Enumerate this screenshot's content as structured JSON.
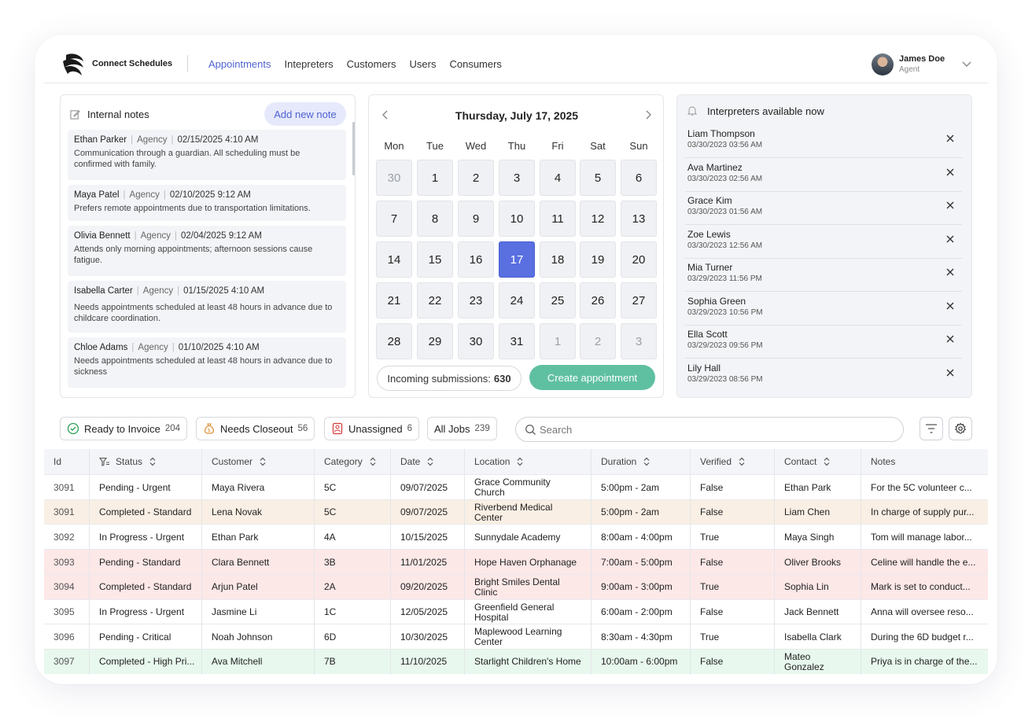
{
  "app": {
    "brand": "Connect Schedules",
    "nav": [
      "Appointments",
      "Intepreters",
      "Customers",
      "Users",
      "Consumers"
    ],
    "active_nav": "Appointments",
    "user": {
      "name": "James Doe",
      "role": "Agent"
    }
  },
  "notes": {
    "title": "Internal notes",
    "add_label": "Add new note",
    "items": [
      {
        "name": "Ethan Parker",
        "org": "Agency",
        "date": "02/15/2025 4:10 AM",
        "text": "Communication through a guardian. All scheduling must be confirmed with family."
      },
      {
        "name": "Maya Patel",
        "org": "Agency",
        "date": "02/10/2025 9:12 AM",
        "text": "Prefers remote appointments due to transportation limitations."
      },
      {
        "name": "Olivia Bennett",
        "org": "Agency",
        "date": "02/04/2025 9:12  AM",
        "text": "Attends only morning appointments; afternoon sessions cause fatigue."
      },
      {
        "name": "Isabella Carter",
        "org": "Agency",
        "date": "01/15/2025 4:10 AM",
        "text": "Needs appointments scheduled at least 48 hours in advance due to childcare coordination."
      },
      {
        "name": "Chloe Adams",
        "org": "Agency",
        "date": "01/10/2025 4:10 AM",
        "text": "Needs appointments scheduled at least 48 hours in advance due to sickness"
      }
    ]
  },
  "calendar": {
    "title": "Thursday, July 17, 2025",
    "weekdays": [
      "Mon",
      "Tue",
      "Wed",
      "Thu",
      "Fri",
      "Sat",
      "Sun"
    ],
    "days": [
      "30",
      "1",
      "2",
      "3",
      "4",
      "5",
      "6",
      "7",
      "8",
      "9",
      "10",
      "11",
      "12",
      "13",
      "14",
      "15",
      "16",
      "17",
      "18",
      "19",
      "20",
      "21",
      "22",
      "23",
      "24",
      "25",
      "26",
      "27",
      "28",
      "29",
      "30",
      "31",
      "1",
      "2",
      "3"
    ],
    "muted_indices": [
      0,
      32,
      33,
      34
    ],
    "selected_index": 17,
    "incoming_label": "Incoming submissions:",
    "incoming_count": "630",
    "create_label": "Create appointment",
    "selected_color": "#5a6fe0",
    "create_color": "#5fc0a1"
  },
  "available": {
    "title": "Interpreters available now",
    "items": [
      {
        "name": "Liam Thompson",
        "time": "03/30/2023 03:56 AM"
      },
      {
        "name": "Ava Martinez",
        "time": "03/30/2023 02:56 AM"
      },
      {
        "name": "Grace Kim",
        "time": "03/30/2023 01:56 AM"
      },
      {
        "name": "Zoe Lewis",
        "time": "03/30/2023 12:56 AM"
      },
      {
        "name": "Mia Turner",
        "time": "03/29/2023 11:56 PM"
      },
      {
        "name": "Sophia Green",
        "time": "03/29/2023 10:56 PM"
      },
      {
        "name": "Ella Scott",
        "time": "03/29/2023 09:56 PM"
      },
      {
        "name": "Lily Hall",
        "time": "03/29/2023 08:56 PM"
      }
    ]
  },
  "filters": [
    {
      "label": "Ready to Invoice",
      "count": "204",
      "icon": "check-circle-icon",
      "color": "#2f9e56"
    },
    {
      "label": "Needs Closeout",
      "count": "56",
      "icon": "money-bag-icon",
      "color": "#d98a2b"
    },
    {
      "label": "Unassigned",
      "count": "6",
      "icon": "person-alert-icon",
      "color": "#d63a3a"
    },
    {
      "label": "All Jobs",
      "count": "239",
      "icon": "",
      "color": ""
    }
  ],
  "search": {
    "placeholder": "Search",
    "value": ""
  },
  "table": {
    "columns": [
      "Id",
      "Status",
      "Customer",
      "Category",
      "Date",
      "Location",
      "Duration",
      "Verified",
      "Contact",
      "Notes"
    ],
    "rows": [
      {
        "tone": "none",
        "cells": [
          "3091",
          "Pending - Urgent",
          "Maya Rivera",
          "5C",
          "09/07/2025",
          "Grace Community Church",
          "5:00pm - 2am",
          "False",
          "Ethan Park",
          "For the 5C volunteer c..."
        ]
      },
      {
        "tone": "orange",
        "cells": [
          "3091",
          "Completed - Standard",
          "Lena Novak",
          "5C",
          "09/07/2025",
          "Riverbend Medical Center",
          "5:00pm - 2am",
          "False",
          "Liam Chen",
          "In charge of supply pur..."
        ]
      },
      {
        "tone": "none",
        "cells": [
          "3092",
          "In Progress - Urgent",
          "Ethan Park",
          "4A",
          "10/15/2025",
          "Sunnydale Academy",
          "8:00am - 4:00pm",
          "True",
          "Maya Singh",
          "Tom will manage labor..."
        ]
      },
      {
        "tone": "red",
        "cells": [
          "3093",
          "Pending - Standard",
          "Clara Bennett",
          "3B",
          "11/01/2025",
          "Hope Haven Orphanage",
          "7:00am - 5:00pm",
          "False",
          "Oliver Brooks",
          "Celine will handle the e..."
        ]
      },
      {
        "tone": "red",
        "cells": [
          "3094",
          "Completed - Standard",
          "Arjun Patel",
          "2A",
          "09/20/2025",
          "Bright Smiles Dental Clinic",
          "9:00am - 3:00pm",
          "True",
          "Sophia Lin",
          "Mark is set to conduct..."
        ]
      },
      {
        "tone": "none",
        "cells": [
          "3095",
          "In Progress - Urgent",
          "Jasmine Li",
          "1C",
          "12/05/2025",
          "Greenfield General Hospital",
          "6:00am - 2:00pm",
          "False",
          "Jack Bennett",
          "Anna will oversee reso..."
        ]
      },
      {
        "tone": "none",
        "cells": [
          "3096",
          "Pending - Critical",
          "Noah Johnson",
          "6D",
          "10/30/2025",
          "Maplewood Learning Center",
          "8:30am - 4:30pm",
          "True",
          "Isabella Clark",
          "During the 6D budget r..."
        ]
      },
      {
        "tone": "green",
        "cells": [
          "3097",
          "Completed - High Pri...",
          "Ava Mitchell",
          "7B",
          "11/10/2025",
          "Starlight Children's Home",
          "10:00am - 6:00pm",
          "False",
          "Mateo Gonzalez",
          "Priya is in charge of the..."
        ]
      }
    ]
  }
}
